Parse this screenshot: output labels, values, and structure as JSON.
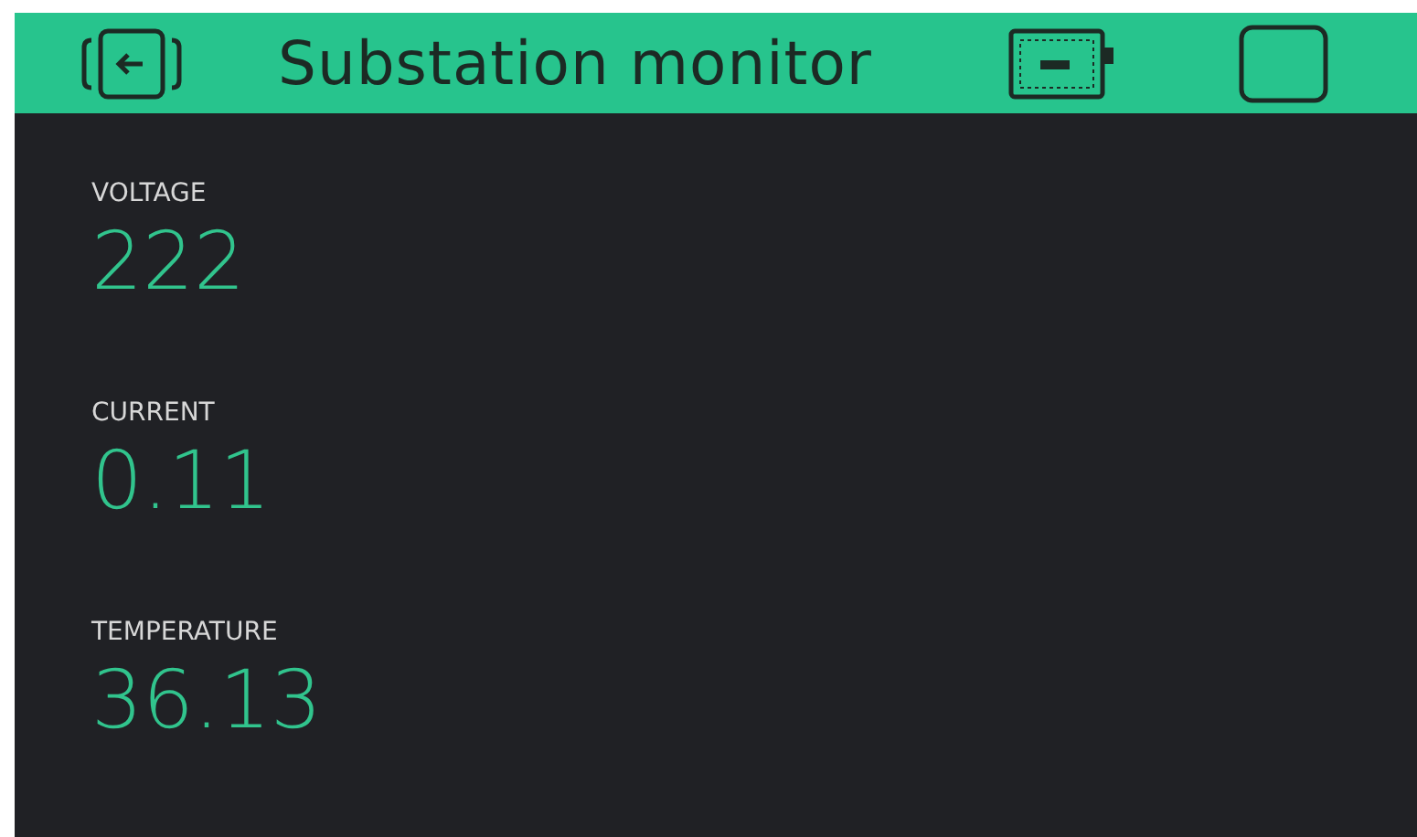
{
  "header": {
    "title": "Substation monitor"
  },
  "widgets": [
    {
      "label": "VOLTAGE",
      "value": "222"
    },
    {
      "label": "CURRENT",
      "value": "0.11"
    },
    {
      "label": "TEMPERATURE",
      "value": "36.13"
    }
  ]
}
